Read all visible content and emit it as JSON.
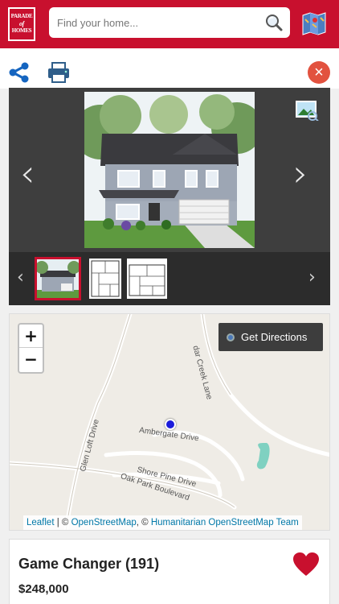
{
  "header": {
    "logo_line1": "PARADE",
    "logo_line2": "of",
    "logo_line3": "HOMES",
    "search_placeholder": "Find your home...",
    "brand_color": "#c8102e",
    "icons": [
      "search-icon",
      "map-icon"
    ]
  },
  "toolbar": {
    "icons": [
      "share-icon",
      "print-icon",
      "close-icon"
    ],
    "share_color": "#1565c0",
    "close_color": "#e2523f"
  },
  "gallery": {
    "prev_arrow": "‹",
    "next_arrow": "›",
    "thumb_prev": "‹",
    "thumb_next": "›",
    "thumbnails": [
      "house-rendering",
      "floor-plan-1",
      "floor-plan-2"
    ],
    "selected_thumbnail": 0
  },
  "map": {
    "zoom_in": "+",
    "zoom_out": "−",
    "directions_label": "Get Directions",
    "streets": {
      "creek": "Cedar Creek Lane",
      "creek_visible": "dar Creek Lane",
      "glen": "Glen Loft Drive",
      "ambergate": "Ambergate Drive",
      "shore": "Shore Pine Drive",
      "oak": "Oak Park Boulevard"
    },
    "attribution": {
      "leaflet": "Leaflet",
      "sep1": " | © ",
      "osm": "OpenStreetMap",
      "sep2": ", © ",
      "hot": "Humanitarian OpenStreetMap Team"
    }
  },
  "listing": {
    "title": "Game Changer (191)",
    "price": "$248,000",
    "favorite_color": "#c8102e"
  }
}
